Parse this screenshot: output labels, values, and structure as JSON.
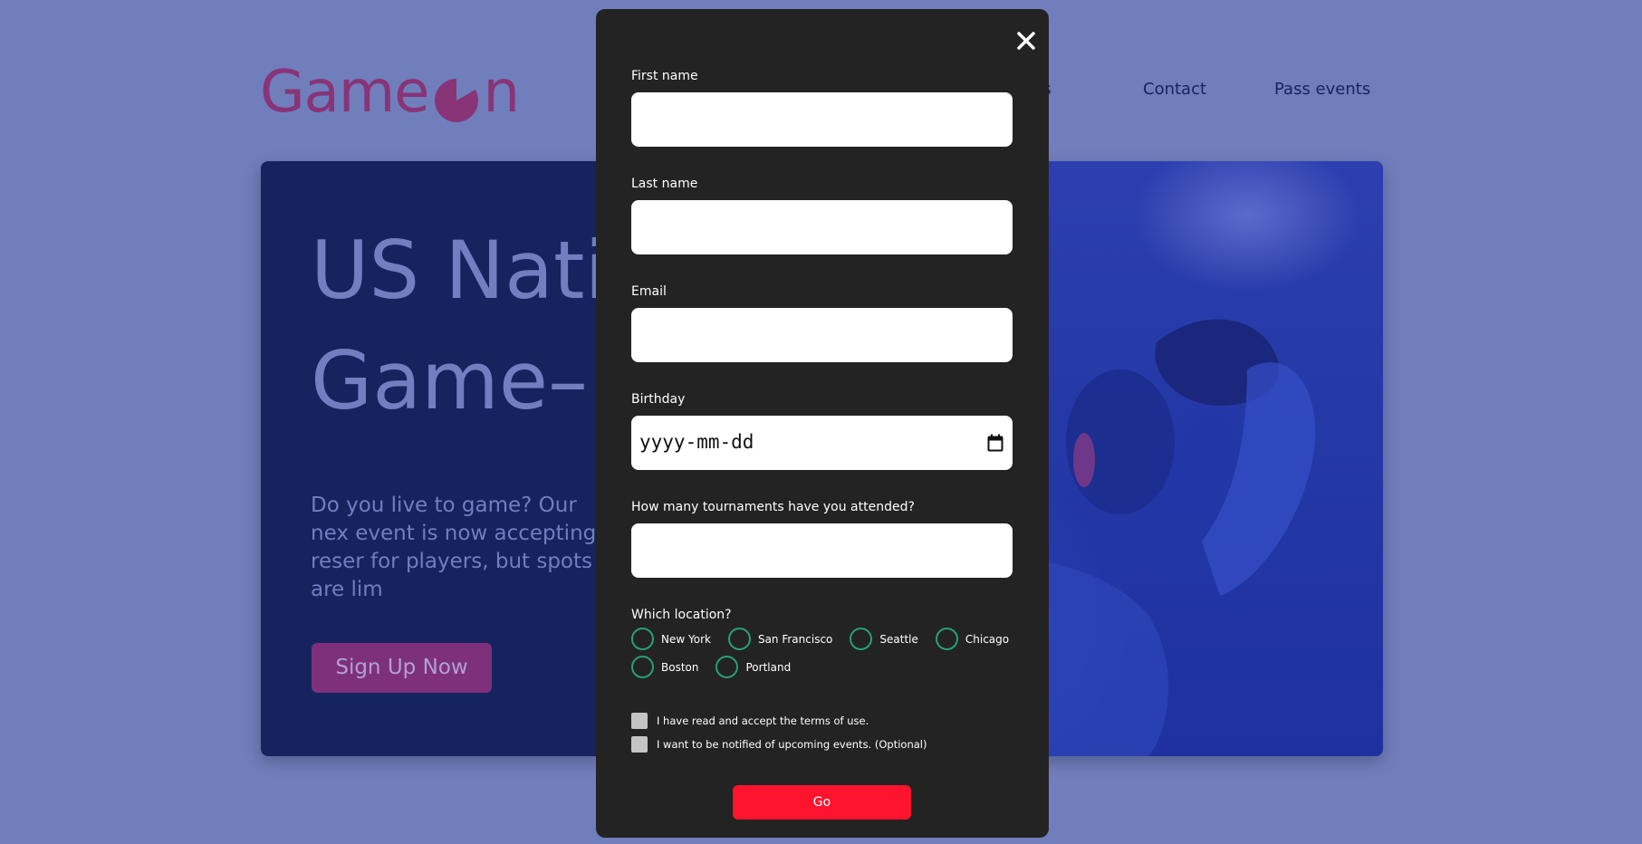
{
  "header": {
    "logo_text_left": "Game",
    "logo_text_right": "n",
    "nav": {
      "about_label": "us",
      "contact_label": "Contact",
      "pass_events_label": "Pass events"
    }
  },
  "hero": {
    "title": "US Nati\nGame–",
    "description": "Do you live to game? Our nex event is now accepting reser for players, but spots are lim",
    "cta_label": "Sign Up Now"
  },
  "modal": {
    "close_icon": "close-icon",
    "fields": {
      "first_name_label": "First name",
      "last_name_label": "Last name",
      "email_label": "Email",
      "birthday_label": "Birthday",
      "birthday_placeholder": "yyyy-mm-dd",
      "tournaments_label": "How many tournaments have you attended?"
    },
    "location": {
      "question": "Which location?",
      "options": [
        "New York",
        "San Francisco",
        "Seattle",
        "Chicago",
        "Boston",
        "Portland"
      ]
    },
    "checkboxes": {
      "terms_label": "I have read and accept the terms of use.",
      "notify_label": "I want to be notified of upcoming events. (Optional)"
    },
    "submit_label": "Go"
  },
  "colors": {
    "page_background": "#707ebc",
    "logo": "#883476",
    "modal_background": "#232323",
    "radio_border": "#279e7a",
    "submit_button": "#fe142f"
  }
}
